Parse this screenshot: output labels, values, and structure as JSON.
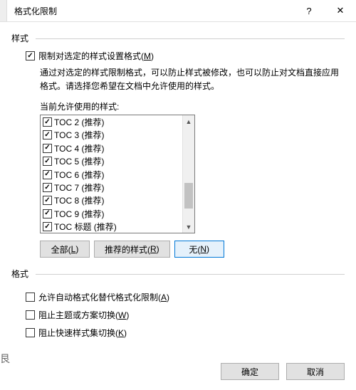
{
  "titlebar": {
    "title": "格式化限制",
    "help": "?",
    "close": "✕"
  },
  "group_style_label": "样式",
  "restrict": {
    "label_pre": "限制对选定的样式设置格式(",
    "mnemonic": "M",
    "label_post": ")",
    "checked": true
  },
  "desc": "通过对选定的样式限制格式，可以防止样式被修改，也可以防止对文档直接应用格式。请选择您希望在文档中允许使用的样式。",
  "list_label": "当前允许使用的样式:",
  "list_items": [
    "TOC 2 (推荐)",
    "TOC 3 (推荐)",
    "TOC 4 (推荐)",
    "TOC 5 (推荐)",
    "TOC 6 (推荐)",
    "TOC 7 (推荐)",
    "TOC 8 (推荐)",
    "TOC 9 (推荐)",
    "TOC 标题 (推荐)"
  ],
  "buttons": {
    "all": {
      "pre": "全部(",
      "m": "L",
      "post": ")"
    },
    "rec": {
      "pre": "推荐的样式(",
      "m": "R",
      "post": ")"
    },
    "none": {
      "pre": "无(",
      "m": "N",
      "post": ")"
    }
  },
  "group_format_label": "格式",
  "opt_autoformat": {
    "pre": "允许自动格式化替代格式化限制(",
    "m": "A",
    "post": ")",
    "checked": false
  },
  "opt_theme": {
    "pre": "阻止主题或方案切换(",
    "m": "W",
    "post": ")",
    "checked": false
  },
  "opt_quick": {
    "pre": "阻止快速样式集切换(",
    "m": "K",
    "post": ")",
    "checked": false
  },
  "footer": {
    "ok": "确定",
    "cancel": "取消"
  },
  "ghost": "艮"
}
